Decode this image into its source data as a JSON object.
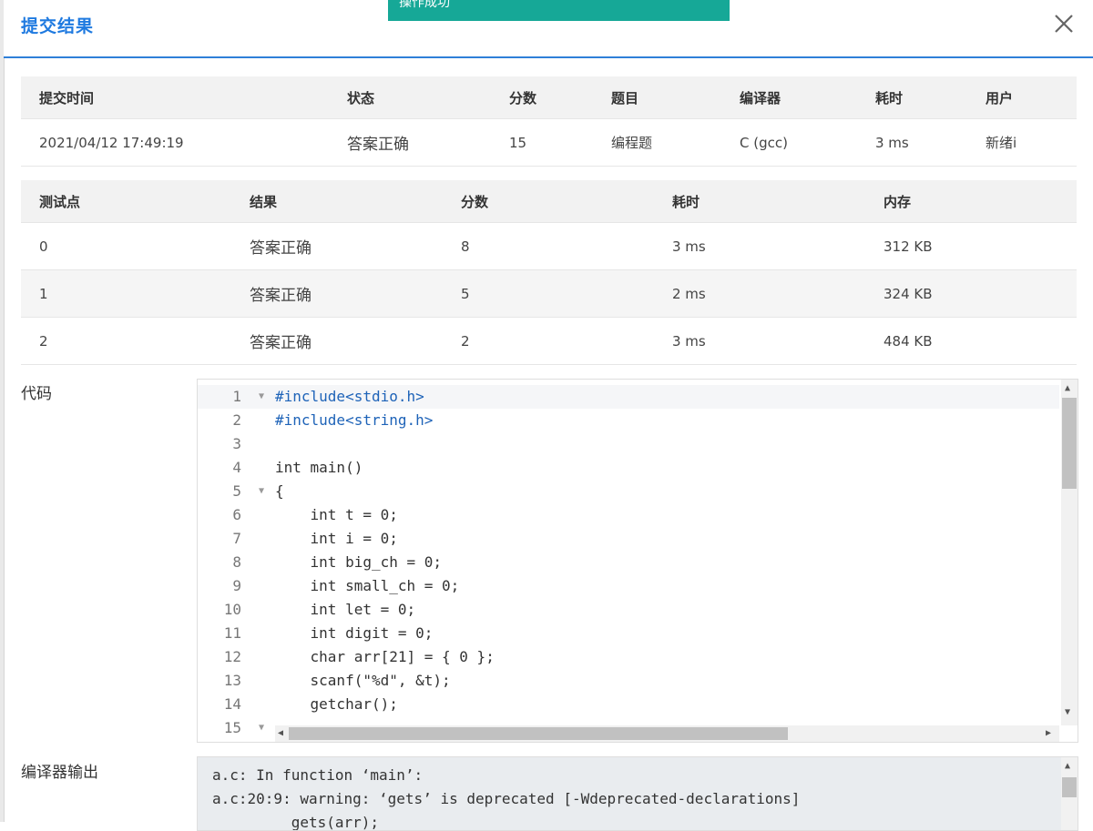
{
  "modal": {
    "title": "提交结果",
    "toast": "操作成功"
  },
  "summary": {
    "headers": [
      "提交时间",
      "状态",
      "分数",
      "题目",
      "编译器",
      "耗时",
      "用户"
    ],
    "row": [
      "2021/04/12 17:49:19",
      "答案正确",
      "15",
      "编程题",
      "C (gcc)",
      "3 ms",
      "新绪i"
    ]
  },
  "tests": {
    "headers": [
      "测试点",
      "结果",
      "分数",
      "耗时",
      "内存"
    ],
    "rows": [
      [
        "0",
        "答案正确",
        "8",
        "3 ms",
        "312 KB"
      ],
      [
        "1",
        "答案正确",
        "5",
        "2 ms",
        "324 KB"
      ],
      [
        "2",
        "答案正确",
        "2",
        "3 ms",
        "484 KB"
      ]
    ]
  },
  "code": {
    "label": "代码",
    "line_numbers": [
      "1",
      "2",
      "3",
      "4",
      "5",
      "6",
      "7",
      "8",
      "9",
      "10",
      "11",
      "12",
      "13",
      "14",
      "15"
    ],
    "lines": [
      "#include<stdio.h>",
      "#include<string.h>",
      "",
      "int main()",
      "{",
      "    int t = 0;",
      "    int i = 0;",
      "    int big_ch = 0;",
      "    int small_ch = 0;",
      "    int let = 0;",
      "    int digit = 0;",
      "    char arr[21] = { 0 };",
      "    scanf(\"%d\", &t);",
      "    getchar();",
      ""
    ]
  },
  "compiler_output": {
    "label": "编译器输出",
    "lines": [
      "a.c: In function ‘main’:",
      "a.c:20:9: warning: ‘gets’ is deprecated [-Wdeprecated-declarations]",
      "         gets(arr);"
    ]
  },
  "colors": {
    "accent": "#1f7ae0",
    "success_text": "#e8453c",
    "toast_bg": "#16a897"
  }
}
